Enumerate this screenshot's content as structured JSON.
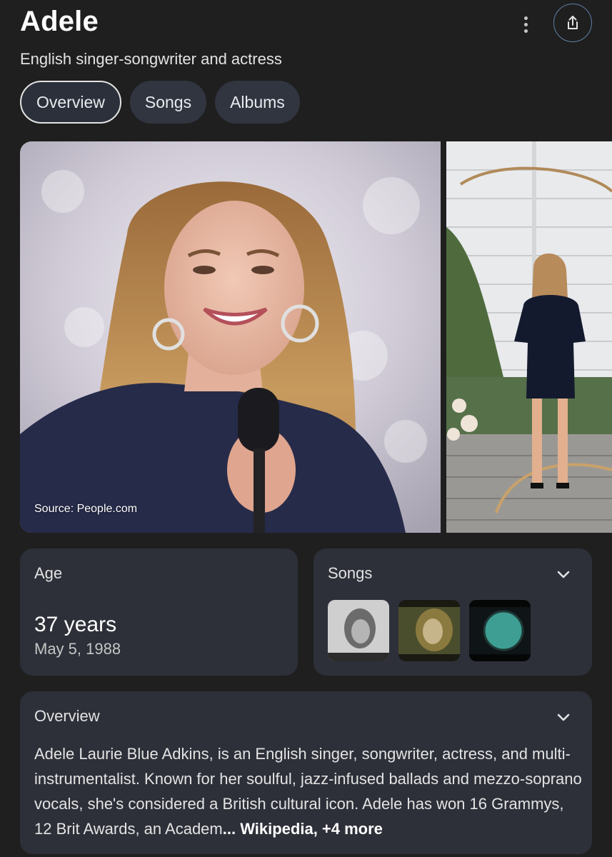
{
  "header": {
    "title": "Adele",
    "subtitle": "English singer-songwriter and actress",
    "more_icon": "more-vert-icon",
    "share_icon": "share-icon"
  },
  "tabs": [
    {
      "label": "Overview",
      "active": true
    },
    {
      "label": "Songs",
      "active": false
    },
    {
      "label": "Albums",
      "active": false
    }
  ],
  "images": {
    "source_label": "Source: People.com"
  },
  "age_card": {
    "label": "Age",
    "years": "37 years",
    "birth_date": "May 5, 1988"
  },
  "songs_card": {
    "label": "Songs",
    "expand_icon": "chevron-down-icon",
    "thumbnails": [
      "song-thumbnail-1",
      "song-thumbnail-2",
      "song-thumbnail-3"
    ]
  },
  "overview_card": {
    "label": "Overview",
    "expand_icon": "chevron-down-icon",
    "text": "Adele Laurie Blue Adkins, is an English singer, songwriter, actress, and multi-instrumentalist. Known for her soulful, jazz-infused ballads and mezzo-soprano vocals, she's considered a British cultural icon. Adele has won 16 Grammys, 12 Brit Awards, an Academ",
    "ellipsis": "...",
    "source_link": " Wikipedia, +4 more"
  },
  "colors": {
    "background": "#1f1f1f",
    "card": "#2d3039",
    "tab": "#303540",
    "share_border": "#5f7fa8"
  }
}
